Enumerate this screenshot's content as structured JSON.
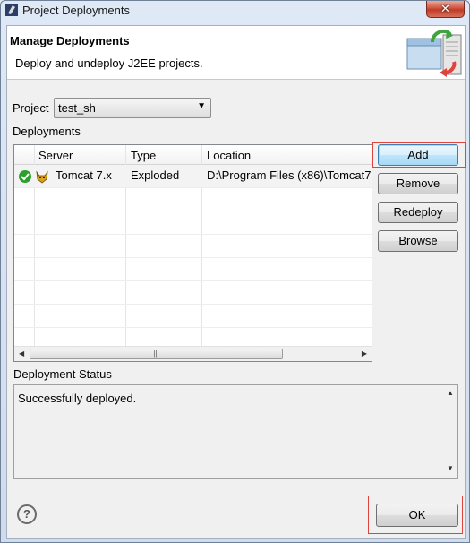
{
  "window": {
    "title": "Project Deployments",
    "close_label": "✕"
  },
  "header": {
    "title": "Manage Deployments",
    "description": "Deploy and undeploy J2EE projects."
  },
  "project": {
    "label": "Project",
    "value": "test_sh"
  },
  "deployments": {
    "label": "Deployments",
    "columns": [
      "Server",
      "Type",
      "Location"
    ],
    "rows": [
      {
        "server": "Tomcat  7.x",
        "type": "Exploded",
        "location": "D:\\Program Files (x86)\\Tomcat7"
      }
    ]
  },
  "buttons": {
    "add": "Add",
    "remove": "Remove",
    "redeploy": "Redeploy",
    "browse": "Browse",
    "ok": "OK"
  },
  "status": {
    "label": "Deployment Status",
    "text": "Successfully deployed."
  },
  "colors": {
    "highlight": "#e0433b",
    "check_green": "#2ca02c"
  }
}
